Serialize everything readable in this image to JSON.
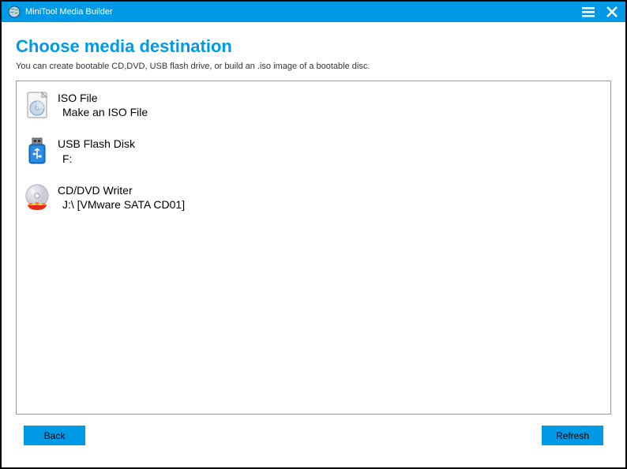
{
  "titlebar": {
    "app_title": "MiniTool Media Builder"
  },
  "page": {
    "title": "Choose media destination",
    "subtitle": "You can create bootable CD,DVD, USB flash drive, or build an .iso image of a bootable disc."
  },
  "options": [
    {
      "icon": "iso-file-icon",
      "title": "ISO File",
      "sub": "Make an ISO File"
    },
    {
      "icon": "usb-flash-icon",
      "title": "USB Flash Disk",
      "sub": "F:"
    },
    {
      "icon": "cd-dvd-icon",
      "title": "CD/DVD Writer",
      "sub": "J:\\ [VMware SATA CD01]"
    }
  ],
  "buttons": {
    "back": "Back",
    "refresh": "Refresh"
  },
  "colors": {
    "accent": "#0099e5"
  }
}
